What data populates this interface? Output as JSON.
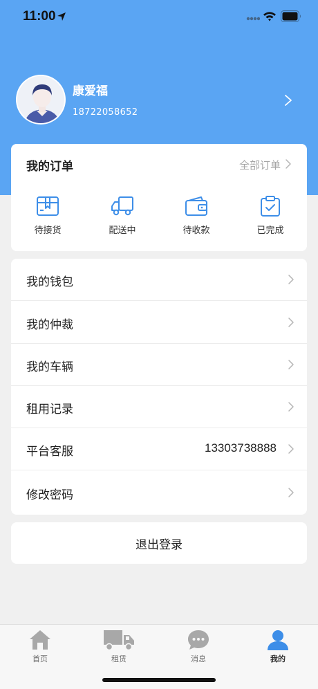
{
  "status_bar": {
    "time": "11:00"
  },
  "profile": {
    "name": "康爱福",
    "phone": "18722058652",
    "avatar_icon": "person-avatar-icon"
  },
  "orders": {
    "title": "我的订单",
    "all_label": "全部订单",
    "items": [
      {
        "label": "待接货",
        "icon": "package-icon"
      },
      {
        "label": "配送中",
        "icon": "truck-icon"
      },
      {
        "label": "待收款",
        "icon": "wallet-icon"
      },
      {
        "label": "已完成",
        "icon": "clipboard-check-icon"
      }
    ]
  },
  "menu": [
    {
      "label": "我的钱包",
      "value": ""
    },
    {
      "label": "我的仲裁",
      "value": ""
    },
    {
      "label": "我的车辆",
      "value": ""
    },
    {
      "label": "租用记录",
      "value": ""
    },
    {
      "label": "平台客服",
      "value": "13303738888"
    },
    {
      "label": "修改密码",
      "value": ""
    }
  ],
  "logout": {
    "label": "退出登录"
  },
  "tabbar": {
    "items": [
      {
        "label": "首页",
        "icon": "home-icon"
      },
      {
        "label": "租赁",
        "icon": "truck-icon"
      },
      {
        "label": "消息",
        "icon": "chat-icon"
      },
      {
        "label": "我的",
        "icon": "person-icon",
        "active": true
      }
    ]
  },
  "colors": {
    "accent": "#5aa5f3",
    "icon_blue": "#3d8ee8",
    "inactive_icon": "#a8a8a8"
  }
}
